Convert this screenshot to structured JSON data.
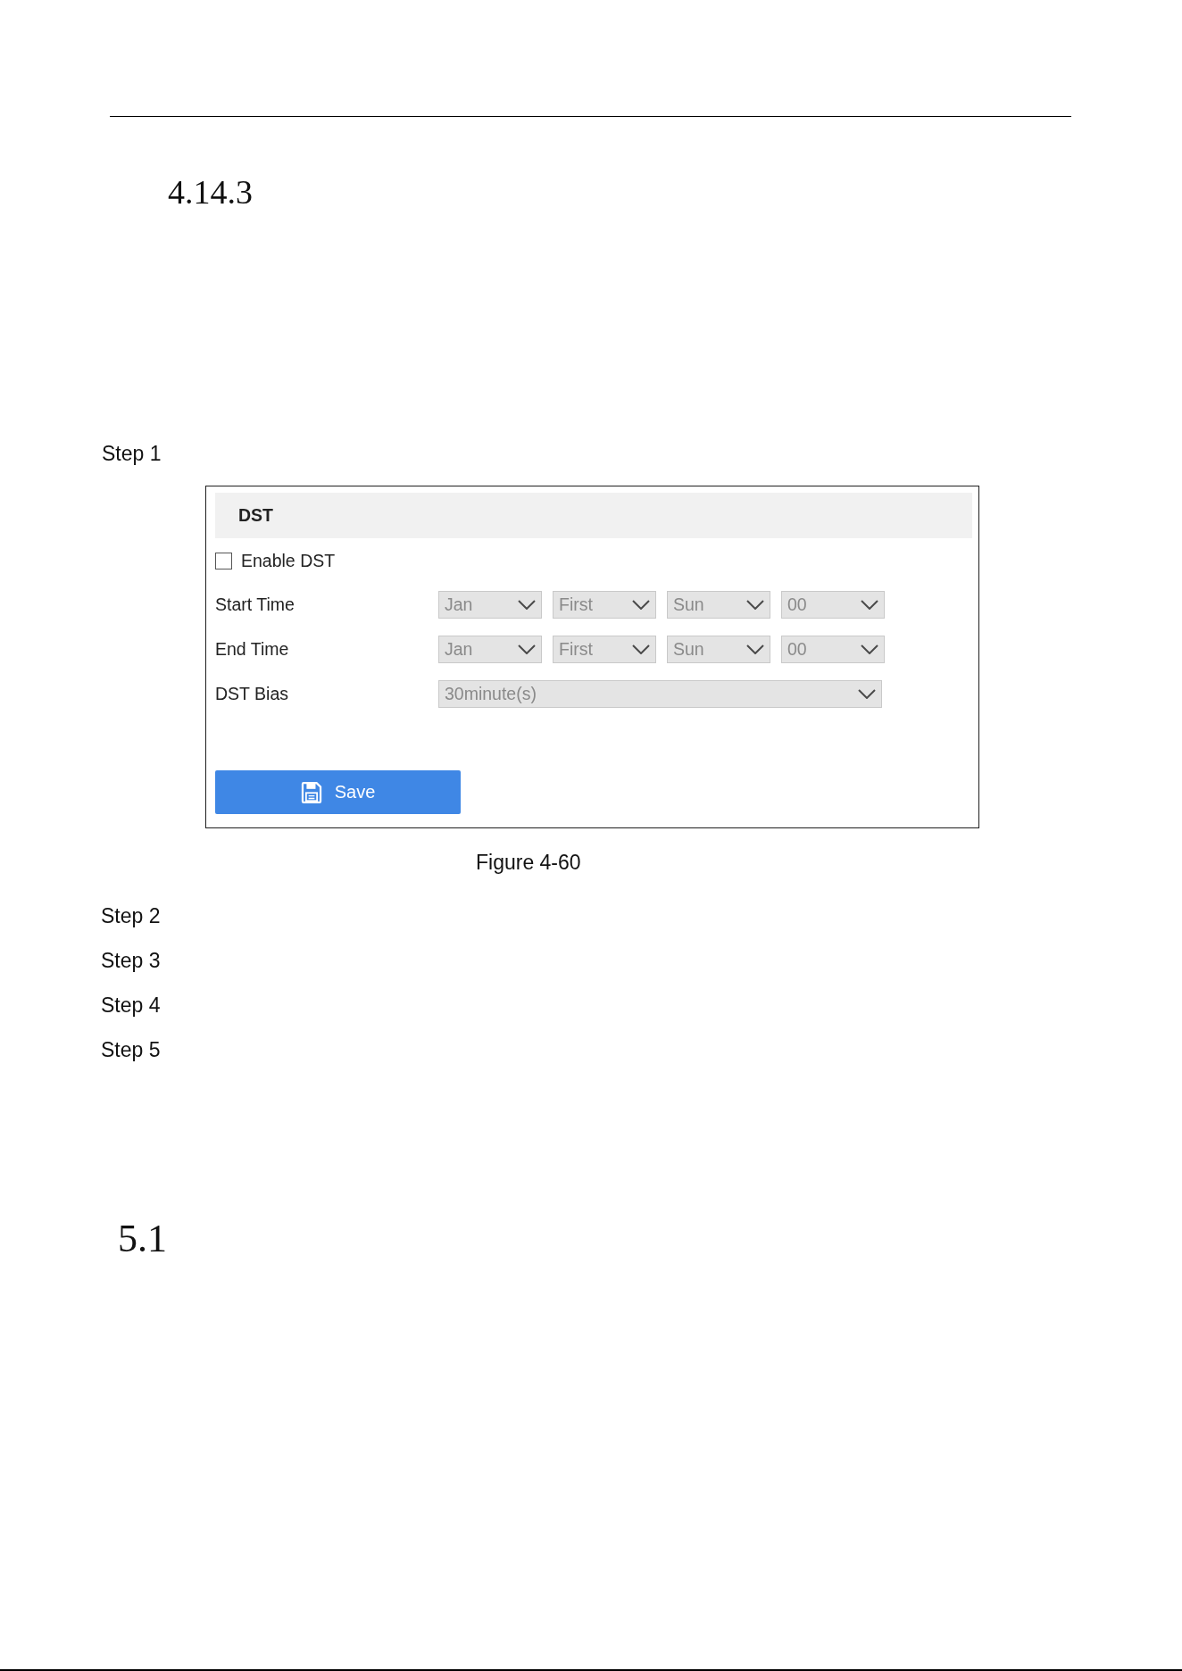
{
  "section": {
    "number": "4.14.3"
  },
  "first_step": {
    "label": "Step 1"
  },
  "figure": {
    "panel": {
      "title": "DST",
      "enable": {
        "label": "Enable DST",
        "checked": false
      },
      "rows": [
        {
          "label": "Start Time",
          "kind": "multi",
          "selects": [
            {
              "value": "Jan",
              "disabled": true
            },
            {
              "value": "First",
              "disabled": true
            },
            {
              "value": "Sun",
              "disabled": true
            },
            {
              "value": "00",
              "disabled": true
            }
          ]
        },
        {
          "label": "End Time",
          "kind": "multi",
          "selects": [
            {
              "value": "Jan",
              "disabled": true
            },
            {
              "value": "First",
              "disabled": true
            },
            {
              "value": "Sun",
              "disabled": true
            },
            {
              "value": "00",
              "disabled": true
            }
          ]
        },
        {
          "label": "DST Bias",
          "kind": "wide",
          "selects": [
            {
              "value": "30minute(s)",
              "disabled": true
            }
          ]
        }
      ],
      "save_button": {
        "label": "Save"
      }
    },
    "caption": "Figure 4-60"
  },
  "later_steps": [
    {
      "label": "Step 2"
    },
    {
      "label": "Step 3"
    },
    {
      "label": "Step 4"
    },
    {
      "label": "Step 5"
    }
  ],
  "next_section": {
    "number": "5.1"
  }
}
